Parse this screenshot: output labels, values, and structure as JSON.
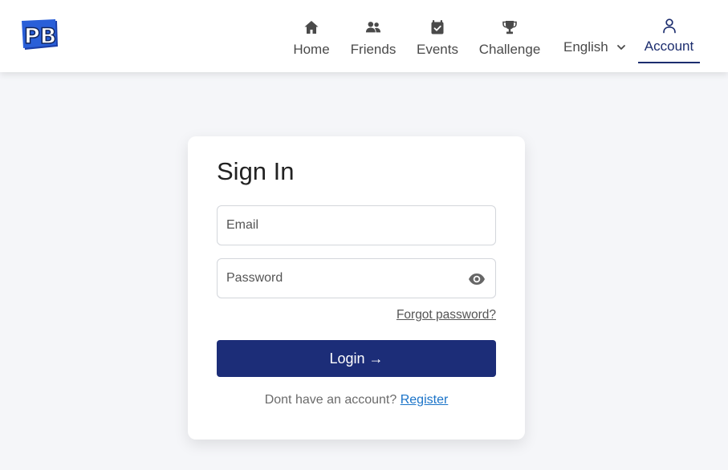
{
  "header": {
    "logo_text": "PB",
    "nav": [
      {
        "label": "Home",
        "icon": "home-icon"
      },
      {
        "label": "Friends",
        "icon": "friends-icon"
      },
      {
        "label": "Events",
        "icon": "calendar-check-icon"
      },
      {
        "label": "Challenge",
        "icon": "trophy-icon"
      }
    ],
    "language": {
      "selected": "English",
      "icon": "chevron-down-icon"
    },
    "account": {
      "label": "Account",
      "icon": "user-icon",
      "active": true
    }
  },
  "signin": {
    "title": "Sign In",
    "email": {
      "placeholder": "Email",
      "value": ""
    },
    "password": {
      "placeholder": "Password",
      "value": "",
      "toggle_icon": "eye-icon"
    },
    "forgot_label": "Forgot password?",
    "login_label": "Login →",
    "register_prompt": "Dont have an account?",
    "register_label": "Register"
  },
  "colors": {
    "primary": "#1c2d78",
    "accent_underline": "#1c2d6e",
    "link": "#1a73c8",
    "page_bg": "#f5f6f9"
  }
}
